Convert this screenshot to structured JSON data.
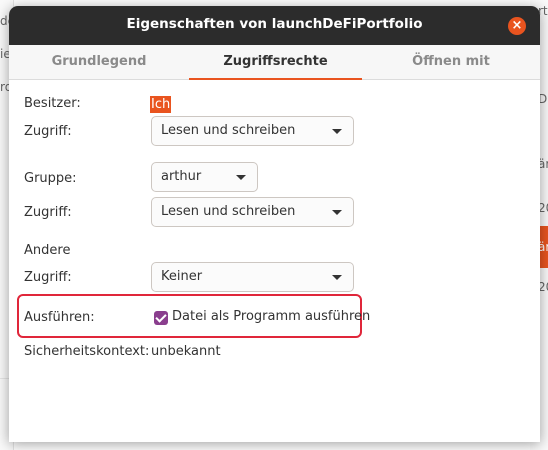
{
  "dialog": {
    "title": "Eigenschaften von launchDeFiPortfolio",
    "close_glyph": "×"
  },
  "tabs": [
    {
      "label": "Grundlegend",
      "active": false
    },
    {
      "label": "Zugriffsrechte",
      "active": true
    },
    {
      "label": "Öffnen mit",
      "active": false
    }
  ],
  "permissions": {
    "owner_label": "Besitzer:",
    "owner_value": "Ich",
    "owner_access_label": "Zugriff:",
    "owner_access_value": "Lesen und schreiben",
    "group_label": "Gruppe:",
    "group_value": "arthur",
    "group_access_label": "Zugriff:",
    "group_access_value": "Lesen und schreiben",
    "others_heading": "Andere",
    "others_access_label": "Zugriff:",
    "others_access_value": "Keiner",
    "execute_label": "Ausführen:",
    "execute_checkbox_label": "Datei als Programm ausführen",
    "execute_checked": true,
    "security_context_label": "Sicherheitskontext:",
    "security_context_value": "unbekannt"
  },
  "background": {
    "left_fragments": [
      "de",
      "ie",
      "rd"
    ],
    "right_fragments": [
      "rt",
      "DI",
      "är",
      "20",
      "är",
      "20"
    ]
  },
  "colors": {
    "accent": "#e9541f",
    "titlebar": "#2c2c2c",
    "checkbox": "#8a3e8e",
    "highlight_box": "#e0263a"
  },
  "icons": {
    "close": "close-icon",
    "dropdown": "chevron-down-icon",
    "checkbox": "checkbox-checked-icon"
  }
}
